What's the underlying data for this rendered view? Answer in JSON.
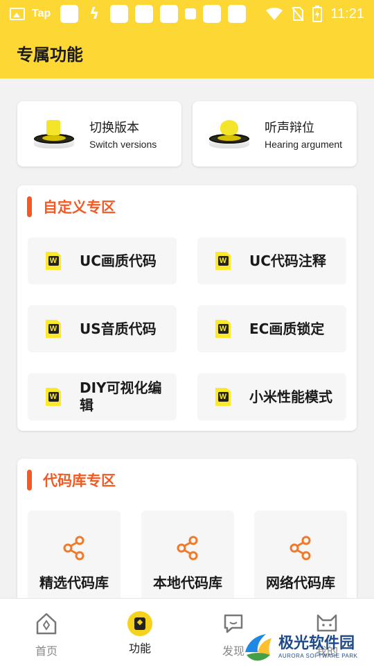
{
  "status_bar": {
    "app_label": "Tap",
    "time": "11:21",
    "icons": [
      "image-icon",
      "tap-icon",
      "bolt-icon",
      "wifi-icon",
      "no-sim-icon",
      "battery-charging-icon"
    ]
  },
  "header": {
    "title": "专属功能"
  },
  "top_cards": [
    {
      "title": "切换版本",
      "subtitle": "Switch versions",
      "icon": "cube-pedestal-icon"
    },
    {
      "title": "听声辩位",
      "subtitle": "Hearing argument",
      "icon": "orb-pedestal-icon"
    }
  ],
  "custom_section": {
    "title": "自定义专区",
    "items": [
      {
        "label": "UC画质代码"
      },
      {
        "label": "UC代码注释"
      },
      {
        "label": "US音质代码"
      },
      {
        "label": "EC画质锁定"
      },
      {
        "label": "DIY可视化编辑"
      },
      {
        "label": "小米性能模式"
      }
    ],
    "item_icon_glyph": "W"
  },
  "code_section": {
    "title": "代码库专区",
    "items": [
      {
        "label": "精选代码库",
        "icon": "share-icon"
      },
      {
        "label": "本地代码库",
        "icon": "share-icon"
      },
      {
        "label": "网络代码库",
        "icon": "share-icon"
      }
    ]
  },
  "bottom_nav": {
    "items": [
      {
        "label": "首页",
        "icon": "home-icon",
        "active": false
      },
      {
        "label": "功能",
        "icon": "bookmark-icon",
        "active": true
      },
      {
        "label": "发现",
        "icon": "chat-icon",
        "active": false
      },
      {
        "label": "我的",
        "icon": "cat-icon",
        "active": false
      }
    ]
  },
  "watermark": {
    "name": "极光软件园",
    "tagline": "AURORA SOFTWARE PARK"
  },
  "colors": {
    "accent_yellow": "#fdd835",
    "section_orange": "#f15a24",
    "share_orange": "#f07a2a",
    "card_bg": "#ffffff",
    "page_bg": "#f2f2f2"
  }
}
